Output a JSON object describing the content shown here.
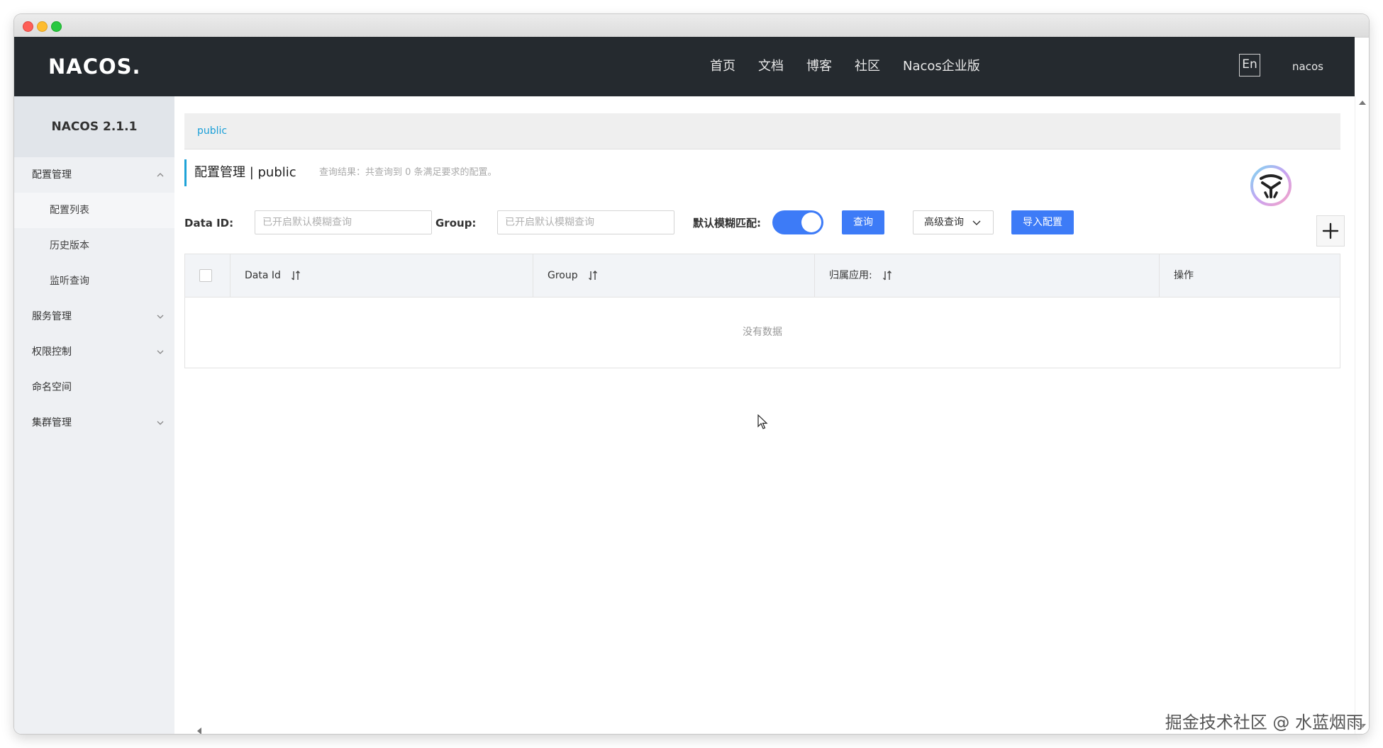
{
  "brand": {
    "logo_text": "NACOS."
  },
  "topnav": {
    "items": [
      "首页",
      "文档",
      "博客",
      "社区",
      "Nacos企业版"
    ],
    "lang": "En",
    "user": "nacos"
  },
  "sidebar": {
    "version": "NACOS 2.1.1",
    "items": [
      {
        "label": "配置管理"
      },
      {
        "label": "配置列表"
      },
      {
        "label": "历史版本"
      },
      {
        "label": "监听查询"
      },
      {
        "label": "服务管理"
      },
      {
        "label": "权限控制"
      },
      {
        "label": "命名空间"
      },
      {
        "label": "集群管理"
      }
    ]
  },
  "main": {
    "namespace": "public",
    "title": "配置管理  |  public",
    "result_hint": "查询结果：共查询到 0 条满足要求的配置。",
    "filters": {
      "data_id_label": "Data ID:",
      "data_id_placeholder": "已开启默认模糊查询",
      "group_label": "Group:",
      "group_placeholder": "已开启默认模糊查询",
      "fuzzy_label": "默认模糊匹配:",
      "fuzzy_on": true
    },
    "buttons": {
      "query": "查询",
      "advanced": "高级查询",
      "import": "导入配置"
    },
    "table": {
      "columns": [
        "Data Id",
        "Group",
        "归属应用:",
        "操作"
      ],
      "empty_text": "没有数据"
    }
  },
  "watermark": "掘金技术社区 @ 水蓝烟雨",
  "colors": {
    "accent": "#3d7bf7",
    "nav_bg": "#252a2f",
    "link": "#1a9fd8"
  }
}
